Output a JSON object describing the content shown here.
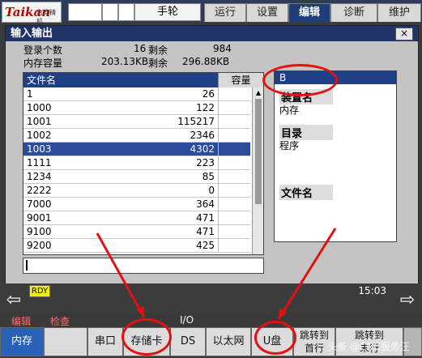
{
  "brand": {
    "logo": "Taikan",
    "logo_sub": "台湾精机"
  },
  "header": {
    "handwheel": "手轮",
    "tabs": [
      {
        "label": "运行",
        "active": false
      },
      {
        "label": "设置",
        "active": false
      },
      {
        "label": "编辑",
        "active": true
      },
      {
        "label": "诊断",
        "active": false
      },
      {
        "label": "维护",
        "active": false
      }
    ]
  },
  "window": {
    "title": "输入输出",
    "close": "×"
  },
  "info": {
    "registered_label": "登录个数",
    "registered_value": "16",
    "remain_label_1": "剩余",
    "remain_value_1": "984",
    "capacity_label": "内存容量",
    "capacity_value": "203.13KB",
    "remain_label_2": "剩余",
    "remain_value_2": "296.88KB"
  },
  "table": {
    "col_name": "文件名",
    "col_size": "容量",
    "rows": [
      {
        "name": "1",
        "size": "26"
      },
      {
        "name": "1000",
        "size": "122"
      },
      {
        "name": "1001",
        "size": "115217"
      },
      {
        "name": "1002",
        "size": "2346"
      },
      {
        "name": "1003",
        "size": "4302"
      },
      {
        "name": "1111",
        "size": "223"
      },
      {
        "name": "1234",
        "size": "85"
      },
      {
        "name": "2222",
        "size": "0"
      },
      {
        "name": "7000",
        "size": "364"
      },
      {
        "name": "9001",
        "size": "471"
      },
      {
        "name": "9100",
        "size": "471"
      },
      {
        "name": "9200",
        "size": "425"
      }
    ],
    "selected_index": 4,
    "scroll_up_icon": "▲"
  },
  "detail": {
    "header": "B",
    "device_label": "装置名",
    "device_value": "内存",
    "dir_label": "目录",
    "dir_value": "程序",
    "file_label": "文件名"
  },
  "status": {
    "ready": "RDY",
    "time": "15:03",
    "left_arrow": "⇦",
    "right_arrow": "⇨"
  },
  "modes": {
    "edit": "编辑",
    "check": "检查",
    "io": "I/O"
  },
  "softkeys": [
    {
      "label": "内存",
      "active": true
    },
    {
      "label": "",
      "active": false
    },
    {
      "label": "串口",
      "active": false
    },
    {
      "label": "存储卡",
      "active": false
    },
    {
      "label": "DS",
      "active": false
    },
    {
      "label": "以太网",
      "active": false
    },
    {
      "label": "U盘",
      "active": false
    },
    {
      "label": "跳转到\n首行",
      "active": false
    },
    {
      "label": "跳转到\n末行",
      "active": false
    }
  ],
  "watermark": "头条 @CNC服务汪"
}
